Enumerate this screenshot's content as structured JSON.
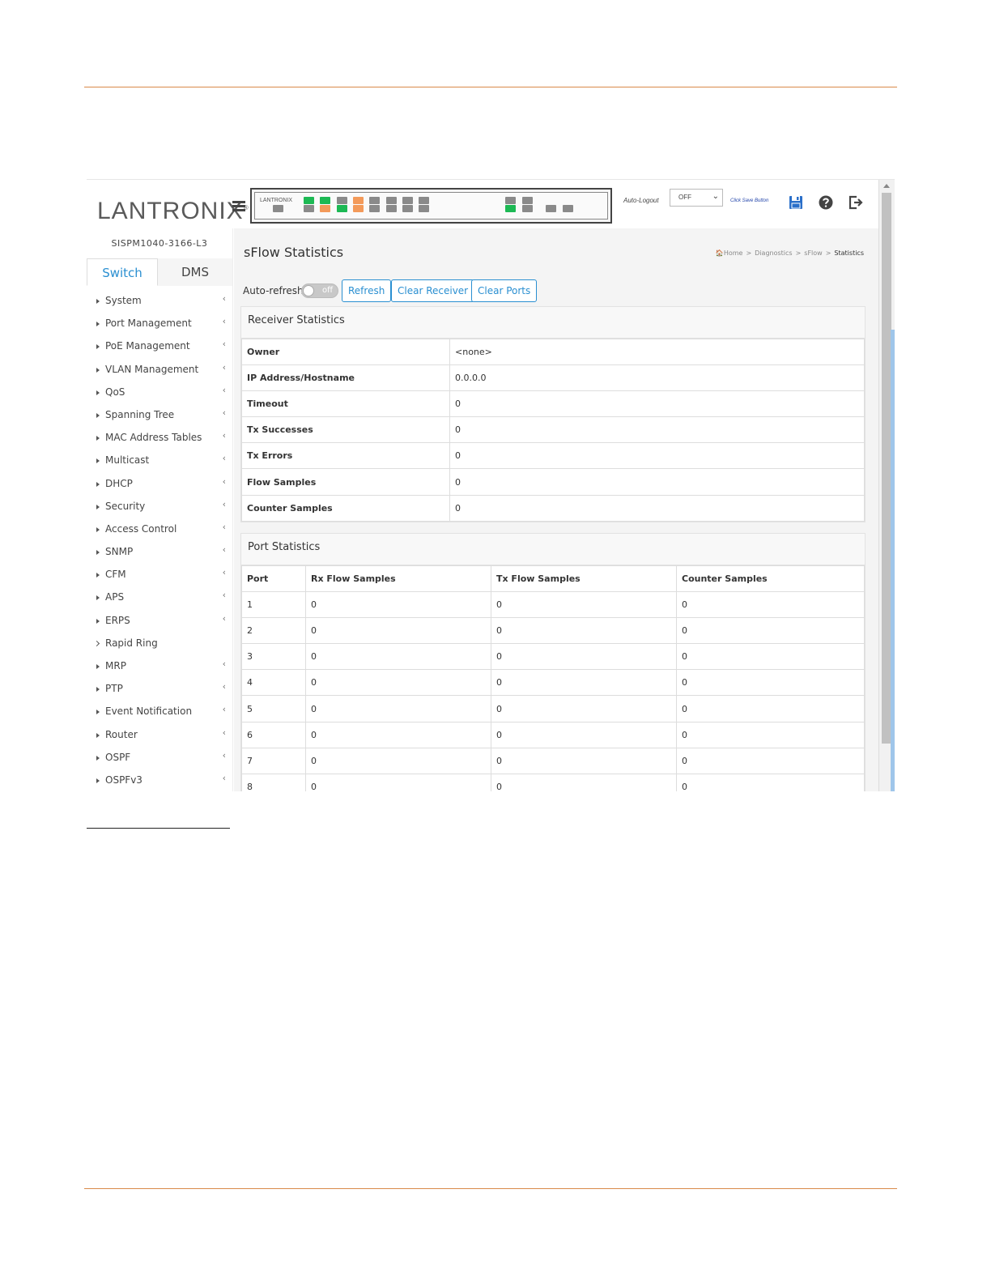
{
  "header": {
    "logo_text": "LANTRONIX",
    "logo_mark": "®",
    "panel_brand": "LANTRONIX",
    "auto_logout_label": "Auto-Logout",
    "auto_logout_value": "OFF",
    "save_hint": "Click Save Button"
  },
  "sidebar": {
    "device_name": "SISPM1040-3166-L3",
    "tabs": [
      "Switch",
      "DMS"
    ],
    "items": [
      "System",
      "Port Management",
      "PoE Management",
      "VLAN Management",
      "QoS",
      "Spanning Tree",
      "MAC Address Tables",
      "Multicast",
      "DHCP",
      "Security",
      "Access Control",
      "SNMP",
      "CFM",
      "APS",
      "ERPS",
      "Rapid Ring",
      "MRP",
      "PTP",
      "Event Notification",
      "Router",
      "OSPF",
      "OSPFv3"
    ]
  },
  "page": {
    "title": "sFlow Statistics",
    "breadcrumb": [
      "Home",
      "Diagnostics",
      "sFlow",
      "Statistics"
    ],
    "auto_refresh_label": "Auto-refresh",
    "toggle_state": "off",
    "buttons": [
      "Refresh",
      "Clear Receiver",
      "Clear Ports"
    ]
  },
  "receiver": {
    "title": "Receiver Statistics",
    "rows": [
      {
        "label": "Owner",
        "value": "<none>"
      },
      {
        "label": "IP Address/Hostname",
        "value": "0.0.0.0"
      },
      {
        "label": "Timeout",
        "value": "0"
      },
      {
        "label": "Tx Successes",
        "value": "0"
      },
      {
        "label": "Tx Errors",
        "value": "0"
      },
      {
        "label": "Flow Samples",
        "value": "0"
      },
      {
        "label": "Counter Samples",
        "value": "0"
      }
    ]
  },
  "ports": {
    "title": "Port Statistics",
    "columns": [
      "Port",
      "Rx Flow Samples",
      "Tx Flow Samples",
      "Counter Samples"
    ],
    "rows": [
      [
        "1",
        "0",
        "0",
        "0"
      ],
      [
        "2",
        "0",
        "0",
        "0"
      ],
      [
        "3",
        "0",
        "0",
        "0"
      ],
      [
        "4",
        "0",
        "0",
        "0"
      ],
      [
        "5",
        "0",
        "0",
        "0"
      ],
      [
        "6",
        "0",
        "0",
        "0"
      ],
      [
        "7",
        "0",
        "0",
        "0"
      ],
      [
        "8",
        "0",
        "0",
        "0"
      ]
    ]
  },
  "colors": {
    "accent": "#2a8fd1",
    "port_green": "#1db954",
    "port_orange": "#f39a5a",
    "port_gray": "#8a8a8a",
    "rule": "#d98a4a"
  }
}
